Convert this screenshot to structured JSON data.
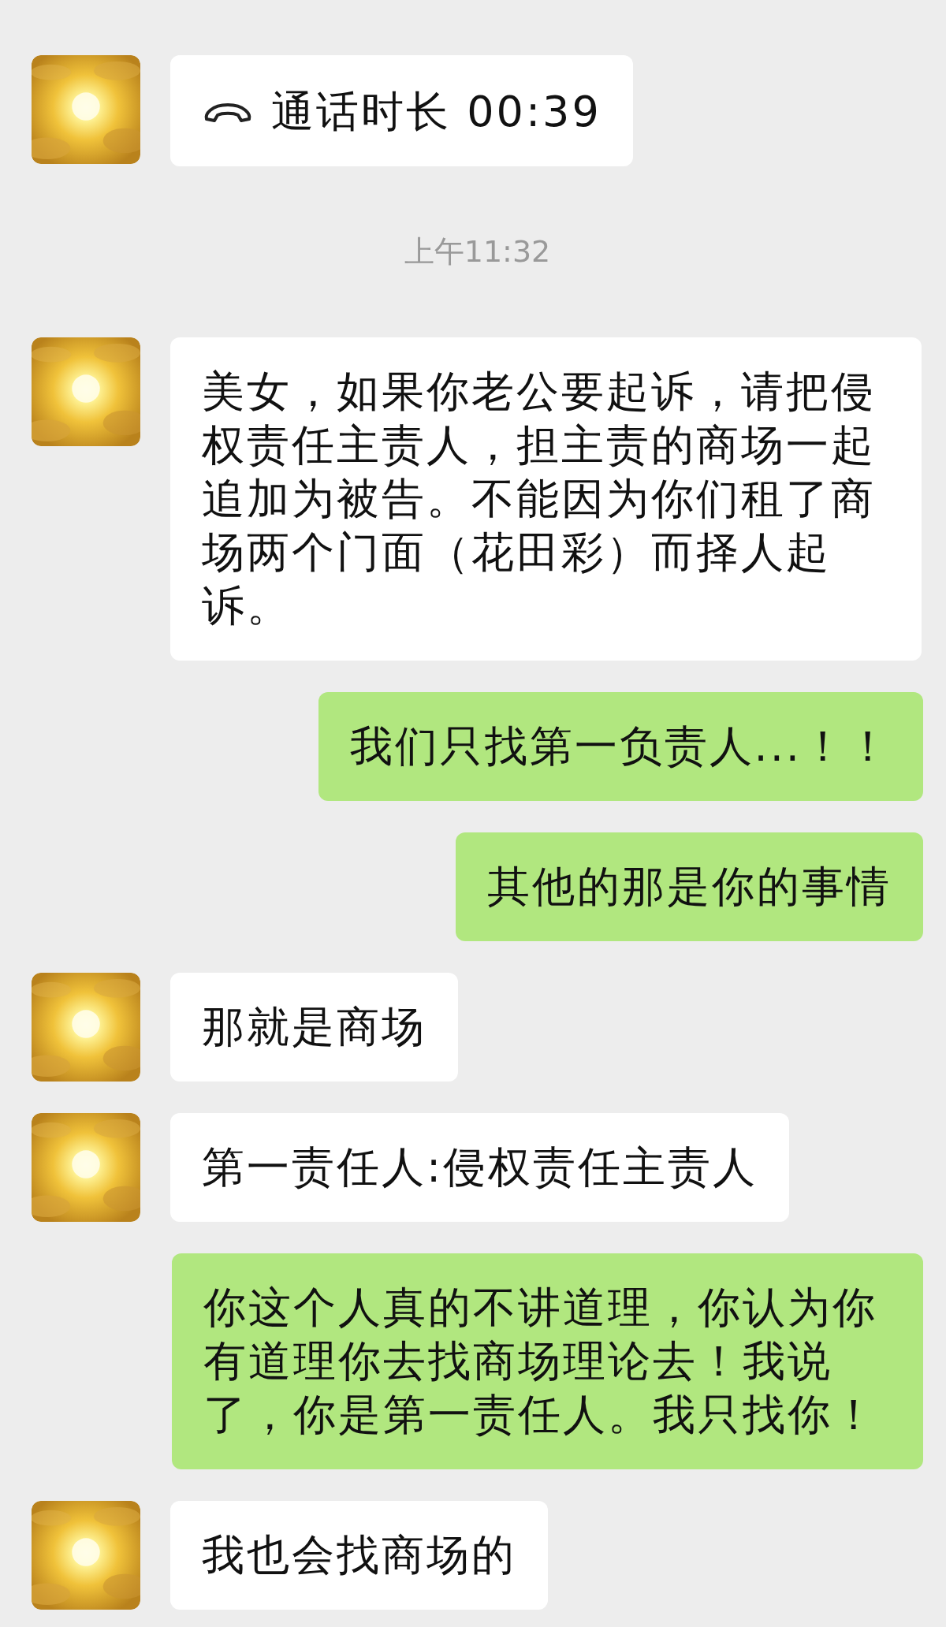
{
  "messages": [
    {
      "kind": "call",
      "outgoing": false,
      "text": "通话时长 00:39"
    },
    {
      "kind": "time",
      "text": "上午11:32"
    },
    {
      "kind": "text",
      "outgoing": false,
      "text": "美女，如果你老公要起诉，请把侵权责任主责人，担主责的商场一起追加为被告。不能因为你们租了商场两个门面（花田彩）而择人起诉。"
    },
    {
      "kind": "text",
      "outgoing": true,
      "text": "我们只找第一负责人...！！"
    },
    {
      "kind": "text",
      "outgoing": true,
      "text": "其他的那是你的事情"
    },
    {
      "kind": "text",
      "outgoing": false,
      "text": "那就是商场"
    },
    {
      "kind": "text",
      "outgoing": false,
      "text": "第一责任人:侵权责任主责人"
    },
    {
      "kind": "text",
      "outgoing": true,
      "text": "你这个人真的不讲道理，你认为你有道理你去找商场理论去！我说了，你是第一责任人。我只找你！"
    },
    {
      "kind": "text",
      "outgoing": false,
      "text": "我也会找商场的"
    }
  ]
}
